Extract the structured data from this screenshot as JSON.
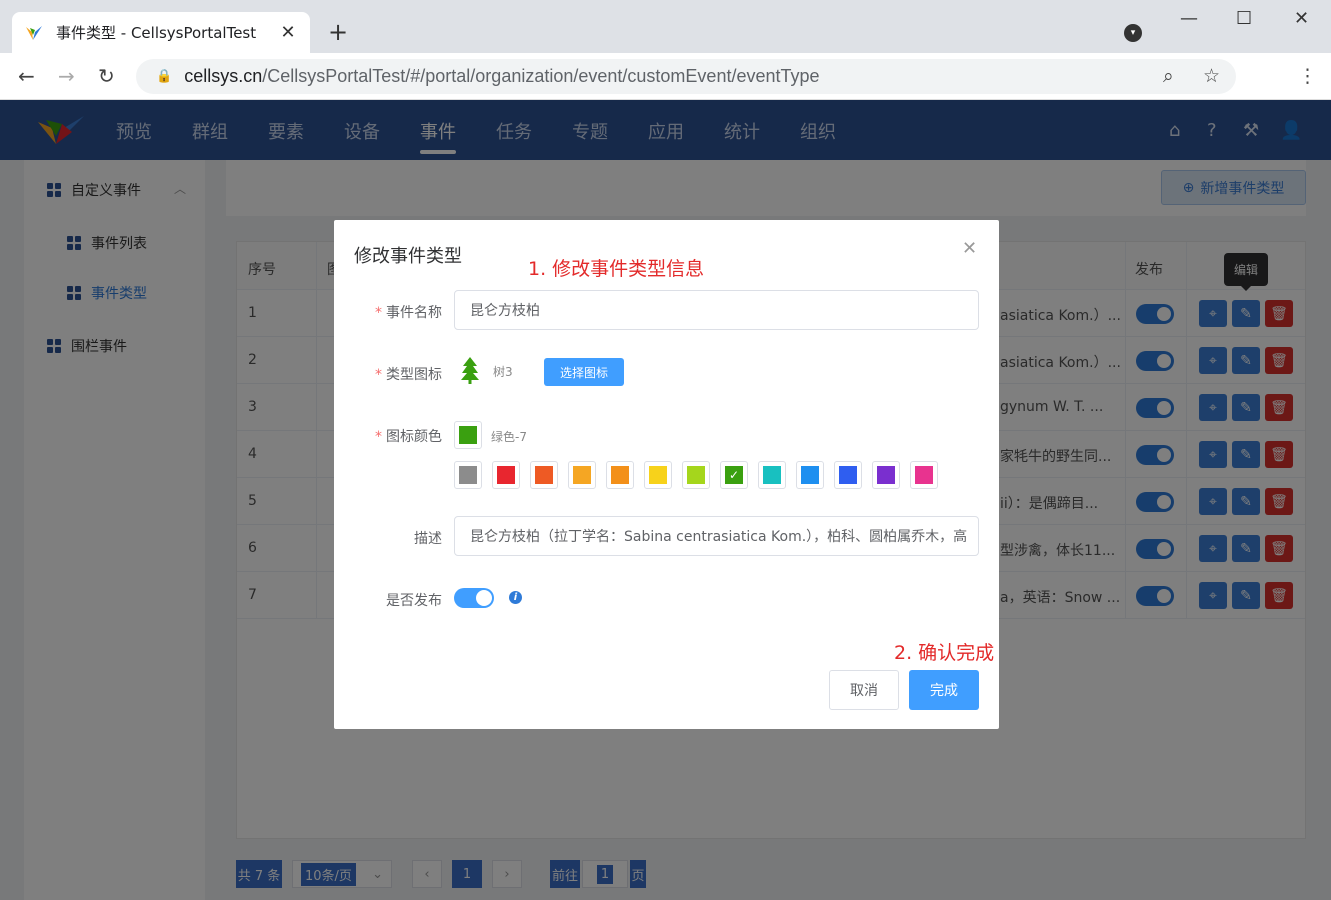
{
  "browser": {
    "tab_title": "事件类型 - CellsysPortalTest",
    "url_host": "cellsys.cn",
    "url_path": "/CellsysPortalTest/#/portal/organization/event/customEvent/eventType"
  },
  "appnav": {
    "menu": [
      "预览",
      "群组",
      "要素",
      "设备",
      "事件",
      "任务",
      "专题",
      "应用",
      "统计",
      "组织"
    ],
    "active": "事件"
  },
  "sidebar": {
    "items": [
      {
        "label": "自定义事件"
      },
      {
        "label": "事件列表"
      },
      {
        "label": "事件类型"
      },
      {
        "label": "围栏事件"
      }
    ]
  },
  "main": {
    "add_button": "新增事件类型",
    "columns": {
      "index": "序号",
      "icon_partial": "图",
      "publish": "发布"
    },
    "rows": [
      {
        "index": "1",
        "desc_tail": "asiatica Kom.）..."
      },
      {
        "index": "2",
        "desc_tail": "asiatica Kom.）..."
      },
      {
        "index": "3",
        "desc_tail": "gynum W. T. ..."
      },
      {
        "index": "4",
        "desc_tail": "家牦牛的野生同..."
      },
      {
        "index": "5",
        "desc_tail": "ii）：是偶蹄目..."
      },
      {
        "index": "6",
        "desc_tail": "型涉禽，体长11..."
      },
      {
        "index": "7",
        "desc_tail": "a，英语：Snow ..."
      }
    ],
    "tooltip": "编辑"
  },
  "pagination": {
    "total": "共 7 条",
    "page_size": "10条/页",
    "current_page": "1",
    "goto_prefix": "前往",
    "goto_value": "1",
    "goto_suffix": "页"
  },
  "dialog": {
    "title": "修改事件类型",
    "annotation_1": "1. 修改事件类型信息",
    "annotation_2": "2. 确认完成",
    "fields": {
      "name_label": "事件名称",
      "name_value": "昆仑方枝柏",
      "icon_label": "类型图标",
      "icon_name": "树3",
      "pick_icon_button": "选择图标",
      "color_label": "图标颜色",
      "color_name": "绿色-7",
      "desc_label": "描述",
      "desc_value": "昆仑方枝柏（拉丁学名：Sabina centrasiatica Kom.），柏科、圆柏属乔木，高",
      "publish_label": "是否发布"
    },
    "current_color": "#3aa010",
    "swatches": [
      "#8c8c8c",
      "#e8262f",
      "#ee5a24",
      "#f5a623",
      "#f39019",
      "#f7d21b",
      "#a5d61c",
      "#3aa010",
      "#18c0c0",
      "#1e8ff0",
      "#2f5ef0",
      "#7a2fcf",
      "#e8338f"
    ],
    "selected_swatch_index": 7,
    "cancel_button": "取消",
    "ok_button": "完成"
  }
}
